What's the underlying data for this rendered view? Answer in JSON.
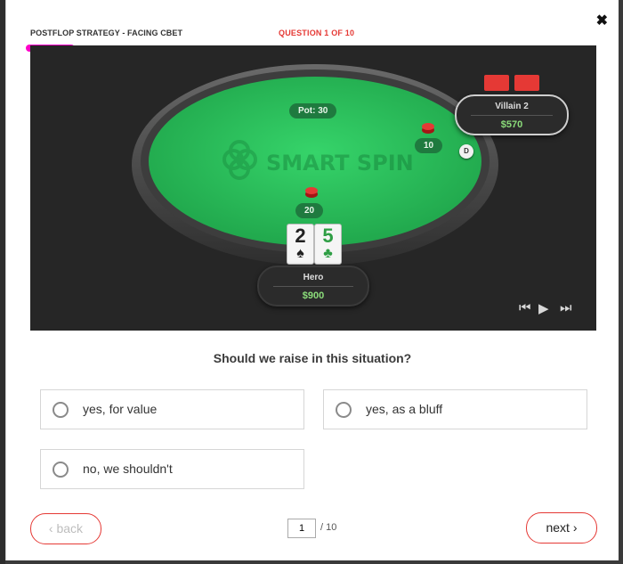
{
  "header": {
    "title": "POSTFLOP STRATEGY - FACING CBET",
    "question_counter": "QUESTION 1 OF 10",
    "close_symbol": "✖"
  },
  "table": {
    "pot_label": "Pot: 30",
    "watermark": "SMART SPIN",
    "villain": {
      "name": "Villain 2",
      "stack": "$570",
      "bet": "10"
    },
    "hero": {
      "name": "Hero",
      "stack": "$900",
      "bet": "20"
    },
    "dealer_button": "D",
    "hero_cards": [
      {
        "rank": "2",
        "suit": "♠"
      },
      {
        "rank": "5",
        "suit": "♣"
      }
    ],
    "controls": {
      "prev": "⏮",
      "play": "▶",
      "next": "⏭"
    }
  },
  "question": "Should we raise in this situation?",
  "options": [
    {
      "label": "yes, for value"
    },
    {
      "label": "yes, as a bluff"
    },
    {
      "label": "no, we shouldn't"
    }
  ],
  "nav": {
    "back_label": "back",
    "next_label": "next",
    "page_value": "1",
    "page_total": "/ 10",
    "back_icon": "‹",
    "next_icon": "›"
  },
  "colors": {
    "accent": "#e53935",
    "felt": "#2fbd5e",
    "underline": "#ff00c8"
  }
}
